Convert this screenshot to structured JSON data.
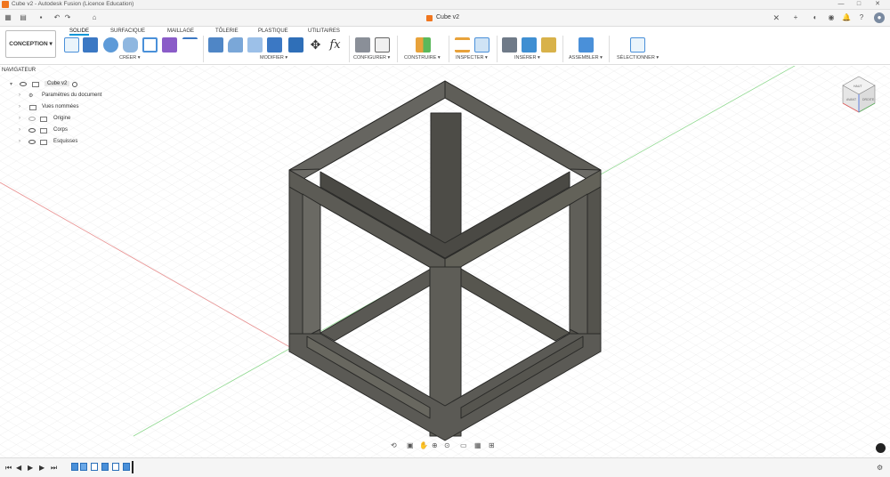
{
  "window": {
    "title": "Cube v2 - Autodesk Fusion (Licence Education)"
  },
  "document_tab": {
    "title": "Cube v2"
  },
  "ribbon": {
    "workspace": "CONCEPTION ▾",
    "tabs": [
      "SOLIDE",
      "SURFACIQUE",
      "MAILLAGE",
      "TÔLERIE",
      "PLASTIQUE",
      "UTILITAIRES"
    ],
    "groups": [
      "CRÉER ▾",
      "MODIFIER ▾",
      "CONFIGURER ▾",
      "CONSTRUIRE ▾",
      "INSPECTER ▾",
      "INSÉRER ▾",
      "ASSEMBLER ▾",
      "SÉLECTIONNER ▾"
    ]
  },
  "navigator": {
    "header": "NAVIGATEUR",
    "root": "Cube v2",
    "items": [
      "Paramètres du document",
      "Vues nommées",
      "Origine",
      "Corps",
      "Esquisses"
    ]
  },
  "viewcube": {
    "top": "HAUT",
    "front": "AVANT",
    "right": "DROITE"
  },
  "colors": {
    "accent": "#0696d7",
    "body": "#5b5a55",
    "grid": "#d9d9d9",
    "xaxis": "#e07070",
    "yaxis": "#7fd07f"
  }
}
